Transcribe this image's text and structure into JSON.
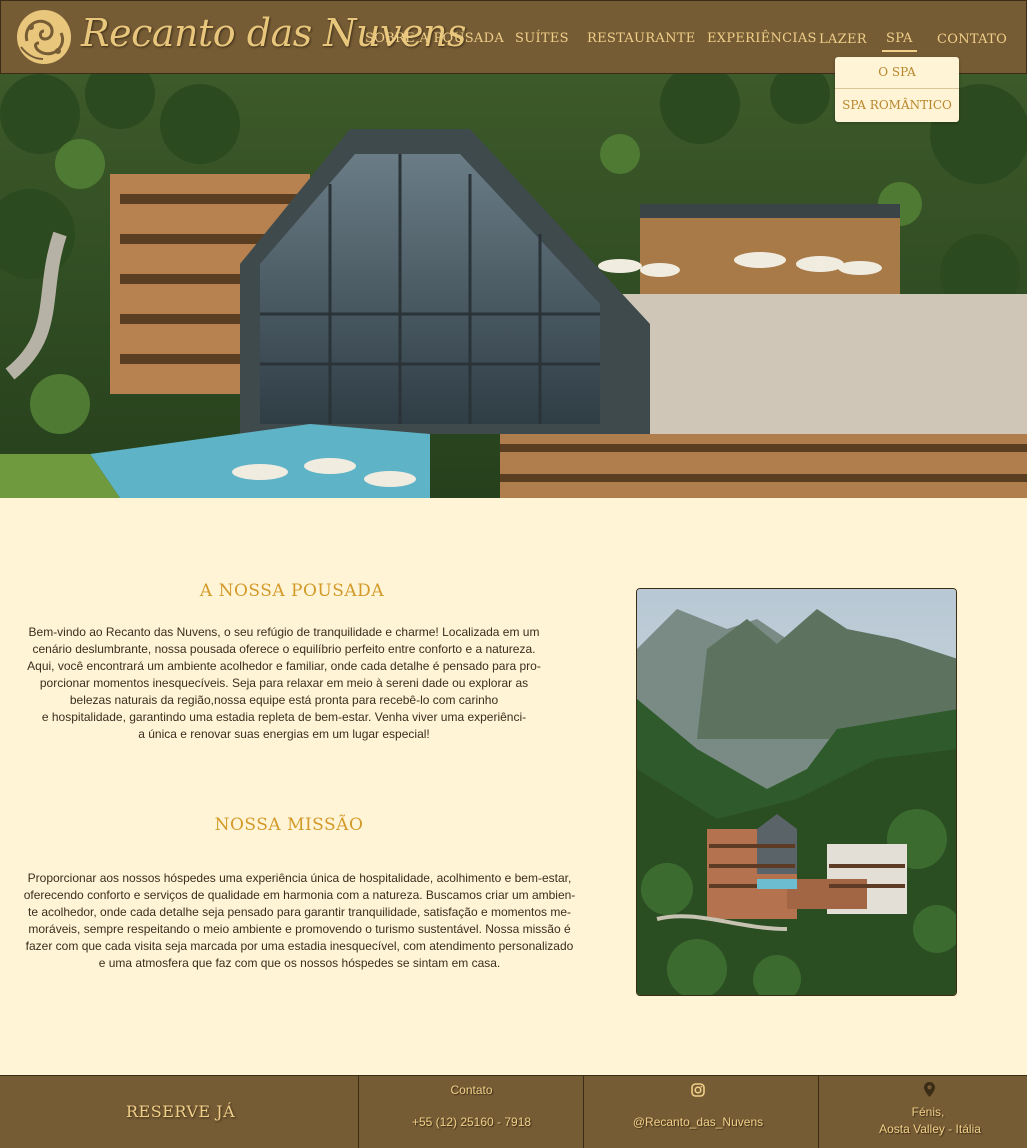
{
  "brand": {
    "name": "Recanto das Nuvens",
    "logo_icon": "ornament-icon"
  },
  "nav": {
    "items": [
      {
        "label": "SOBRE A POUSADA"
      },
      {
        "label": "SUÍTES"
      },
      {
        "label": "RESTAURANTE"
      },
      {
        "label": "EXPERIÊNCIAS"
      },
      {
        "label": "LAZER"
      },
      {
        "label": "SPA"
      },
      {
        "label": "CONTATO"
      }
    ],
    "active": "SPA",
    "dropdown": [
      {
        "label": "O SPA"
      },
      {
        "label": "SPA ROMÂNTICO"
      }
    ]
  },
  "about": {
    "title": "A NOSSA POUSADA",
    "lines": [
      "Bem-vindo ao Recanto das Nuvens, o seu refúgio de tranquilidade e charme! Localizada em um",
      "cenário deslumbrante, nossa pousada oferece o equilíbrio perfeito entre conforto e a natureza.",
      "Aqui, você encontrará um ambiente acolhedor e familiar, onde cada detalhe é pensado para pro-",
      "porcionar momentos inesquecíveis. Seja para relaxar em meio à sereni dade ou explorar as",
      "belezas naturais da região,nossa equipe está pronta para recebê-lo com carinho",
      "e hospitalidade, garantindo uma estadia repleta de bem-estar. Venha viver uma experiênci-",
      "a única e renovar suas energias em um lugar especial!"
    ]
  },
  "mission": {
    "title": "NOSSA MISSÃO",
    "lines": [
      "Proporcionar aos nossos hóspedes uma experiência única de hospitalidade, acolhimento e bem-estar,",
      "oferecendo conforto e serviços de qualidade em harmonia com a natureza. Buscamos criar um ambien-",
      "te acolhedor, onde cada detalhe seja pensado para garantir tranquilidade, satisfação e momentos me-",
      "moráveis, sempre respeitando o meio ambiente e promovendo o turismo sustentável. Nossa missão é",
      "fazer com que cada visita seja marcada por uma estadia inesquecível, com atendimento personalizado",
      "e uma atmosfera que faz com que os nossos hóspedes se sintam em casa."
    ]
  },
  "footer": {
    "reserve_label": "RESERVE JÁ",
    "contact_label": "Contato",
    "phone": "+55 (12) 25160 - 7918",
    "instagram_icon": "instagram-icon",
    "instagram_handle": "@Recanto_das_Nuvens",
    "location_icon": "map-pin-icon",
    "location_line1": "Fénis,",
    "location_line2": "Aosta Valley -  Itália"
  },
  "colors": {
    "header_bg": "#765c35",
    "nav_text": "#f0cf88",
    "page_bg": "#fff4d6",
    "title_gold": "#d39a2a",
    "body_text": "#3a2e1e"
  }
}
